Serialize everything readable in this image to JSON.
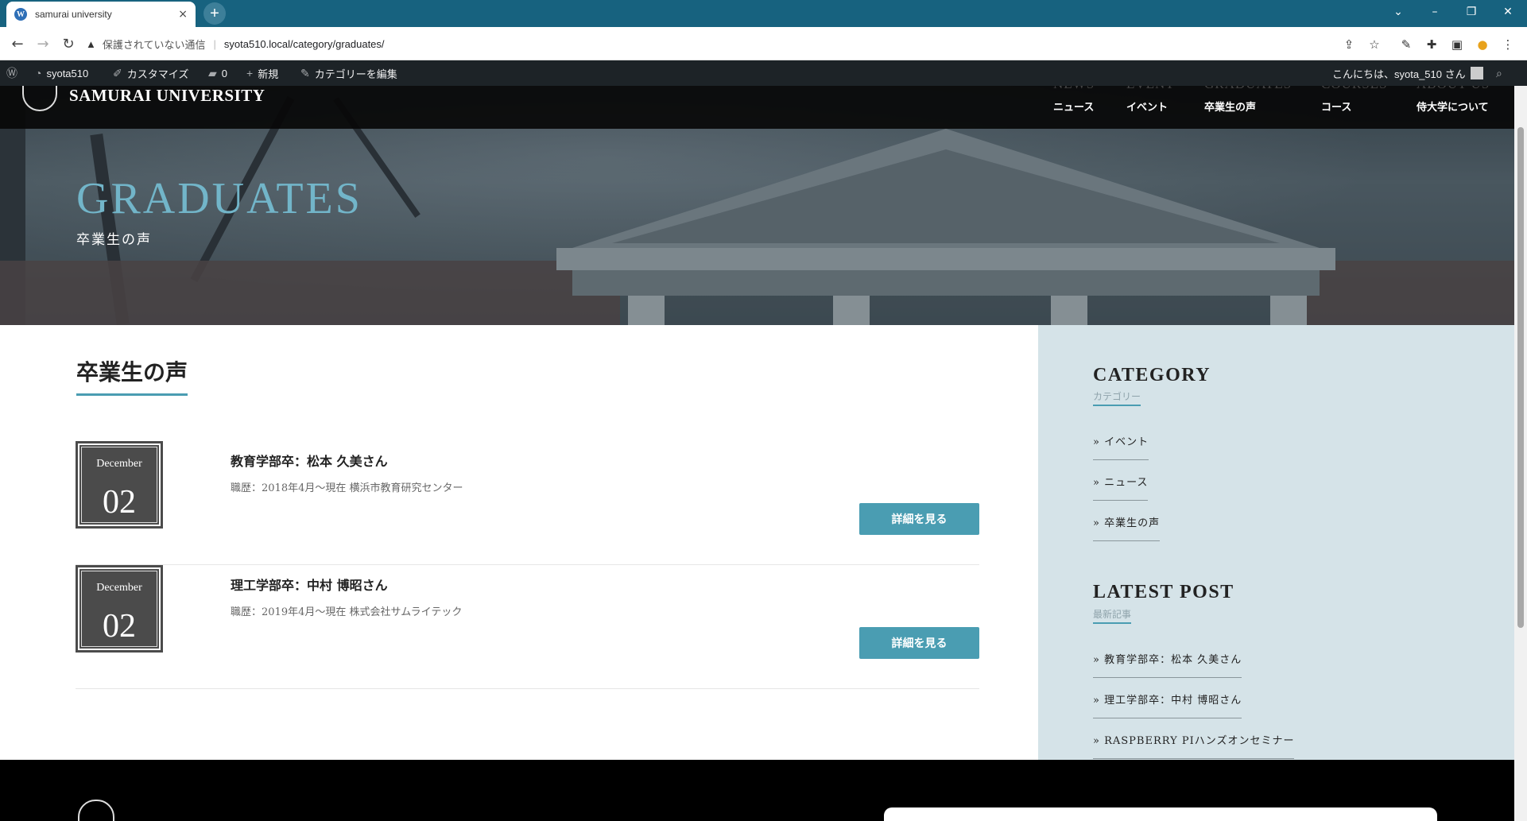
{
  "browser": {
    "tab_title": "samurai university",
    "tab_close": "×",
    "new_tab": "+",
    "security_label": "保護されていない通信",
    "url": "syota510.local/category/graduates/",
    "window_controls": [
      "⌄",
      "–",
      "❐",
      "✕"
    ]
  },
  "adminbar": {
    "site_name": "syota510",
    "customize": "カスタマイズ",
    "comments_count": "0",
    "new": "新規",
    "edit_category": "カテゴリーを編集",
    "greeting": "こんにちは、syota_510 さん"
  },
  "site": {
    "name": "SAMURAI UNIVERSITY",
    "nav": [
      {
        "en": "NEWS",
        "ja": "ニュース"
      },
      {
        "en": "EVENT",
        "ja": "イベント"
      },
      {
        "en": "GRADUATES",
        "ja": "卒業生の声"
      },
      {
        "en": "COURSES",
        "ja": "コース"
      },
      {
        "en": "ABOUT US",
        "ja": "侍大学について"
      }
    ]
  },
  "hero": {
    "title": "GRADUATES",
    "subtitle": "卒業生の声"
  },
  "main": {
    "section_title": "卒業生の声",
    "posts": [
      {
        "month": "December",
        "day": "02",
        "title": "教育学部卒：松本 久美さん",
        "meta": "職歴：2018年4月～現在 横浜市教育研究センター",
        "button": "詳細を見る"
      },
      {
        "month": "December",
        "day": "02",
        "title": "理工学部卒：中村 博昭さん",
        "meta": "職歴：2019年4月～現在 株式会社サムライテック",
        "button": "詳細を見る"
      }
    ]
  },
  "sidebar": {
    "category_heading": "CATEGORY",
    "category_sub": "カテゴリー",
    "categories": [
      "» イベント",
      "» ニュース",
      "» 卒業生の声"
    ],
    "latest_heading": "LATEST POST",
    "latest_sub": "最新記事",
    "latest": [
      "» 教育学部卒：松本 久美さん",
      "» 理工学部卒：中村 博昭さん",
      "» RASPBERRY PIハンズオンセミナー"
    ]
  },
  "colors": {
    "accent": "#4a9db2",
    "tabbar": "#17627f",
    "sidebar_bg": "#d5e3e8",
    "adminbar": "#1d2327"
  }
}
